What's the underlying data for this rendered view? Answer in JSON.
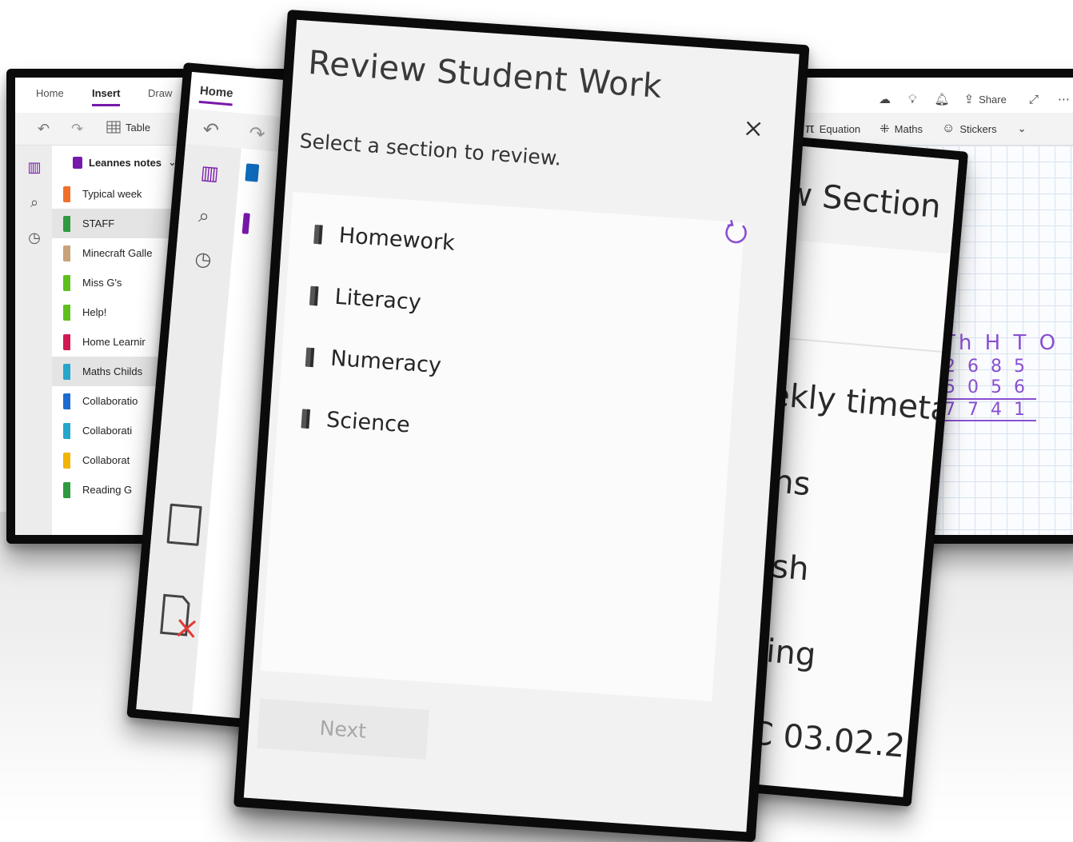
{
  "back_window": {
    "tabs": [
      "Home",
      "Insert",
      "Draw"
    ],
    "ribbon": {
      "table_label": "Table",
      "equation_label": "Equation",
      "maths_label": "Maths",
      "stickers_label": "Stickers"
    },
    "share_label": "Share",
    "notebook_name": "Leannes notes",
    "sections": [
      {
        "label": "Typical week",
        "color": "#f0702a"
      },
      {
        "label": "STAFF",
        "color": "#2f9a3f"
      },
      {
        "label": "Minecraft Galle",
        "color": "#c8a27a"
      },
      {
        "label": "Miss G's",
        "color": "#5fbf1f"
      },
      {
        "label": "Help!",
        "color": "#5fbf1f"
      },
      {
        "label": "Home Learnir",
        "color": "#d11a52"
      },
      {
        "label": "Maths Childs",
        "color": "#26a6c9"
      },
      {
        "label": "Collaboratio",
        "color": "#1e6bd0"
      },
      {
        "label": "Collaborati",
        "color": "#26a6c9"
      },
      {
        "label": "Collaborat",
        "color": "#f2b400"
      },
      {
        "label": "Reading G",
        "color": "#2f9a3f"
      }
    ],
    "handwriting": {
      "row1": "Th H T O",
      "row2": "2 6 8 5",
      "row3": "5 0 5 6",
      "row4": "7 7 4 1"
    }
  },
  "mid_window": {
    "tab": "Home"
  },
  "right_window": {
    "title": "ew Section",
    "items": [
      "eekly timeta",
      "aths",
      "glish",
      "ading",
      "WC 03.02.2"
    ]
  },
  "dialog": {
    "title": "Review Student Work",
    "subtitle": "Select a section to review.",
    "sections": [
      "Homework",
      "Literacy",
      "Numeracy",
      "Science"
    ],
    "next_label": "Next"
  },
  "colors": {
    "accent": "#7719aa",
    "refresh": "#8a4fd0"
  }
}
